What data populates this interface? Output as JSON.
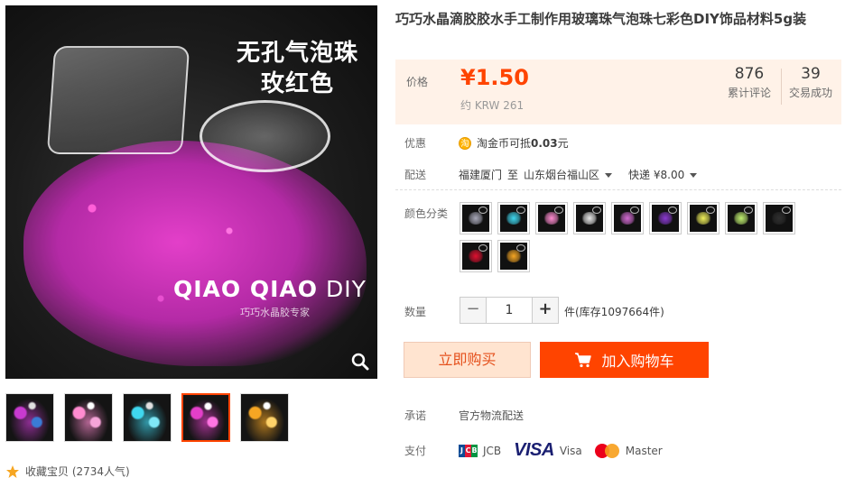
{
  "gallery": {
    "main_overlay_title_line1": "无孔气泡珠",
    "main_overlay_title_line2": "玫红色",
    "brand_bold": "QIAO QIAO",
    "brand_light": " DIY",
    "brand_sub": "巧巧水晶胶专家",
    "zoom_icon": "search-icon",
    "thumbnails": [
      {
        "colors": [
          "#c83ad0",
          "#3a7bd5",
          "#e0e0e0"
        ]
      },
      {
        "colors": [
          "#ff8bd0",
          "#f6a5d9",
          "#ffffff"
        ]
      },
      {
        "colors": [
          "#3fd7ef",
          "#7fe8f7",
          "#e0e0e0"
        ]
      },
      {
        "colors": [
          "#e33fc9",
          "#ff74e2",
          "#ffffff"
        ],
        "active": true
      },
      {
        "colors": [
          "#f6a623",
          "#ffd36a",
          "#ffffff"
        ]
      }
    ],
    "favorite_label": "收藏宝贝 (2734人气)",
    "favorite_icon": "star-icon"
  },
  "product": {
    "title": "巧巧水晶滴胶胶水手工制作用玻璃珠气泡珠七彩色DIY饰品材料5g装"
  },
  "price": {
    "label": "价格",
    "value": "¥1.50",
    "krw": "约 KRW 261",
    "reviews_count": "876",
    "reviews_label": "累计评论",
    "deals_count": "39",
    "deals_label": "交易成功"
  },
  "promo": {
    "label": "优惠",
    "coin_icon": "taojinbi-coin-icon",
    "coin_symbol": "淘",
    "text_prefix": "淘金币可抵",
    "text_amount": "0.03",
    "text_suffix": "元"
  },
  "shipping": {
    "label": "配送",
    "from": "福建厦门",
    "to_word": "至",
    "to": "山东烟台福山区",
    "method": "快递 ¥8.00"
  },
  "colors": {
    "label": "颜色分类",
    "swatches": [
      {
        "fill": "#a8a8b8"
      },
      {
        "fill": "#3fd7ef"
      },
      {
        "fill": "#ff8bd0"
      },
      {
        "fill": "#e8e8e8"
      },
      {
        "fill": "#d06ad0"
      },
      {
        "fill": "#8a3ad0"
      },
      {
        "fill": "#f0f05a"
      },
      {
        "fill": "#c0f070"
      },
      {
        "fill": "#303030"
      },
      {
        "fill": "#e01030"
      },
      {
        "fill": "#f6a623"
      }
    ]
  },
  "quantity": {
    "label": "数量",
    "minus": "−",
    "value": "1",
    "plus": "+",
    "stock": "件(库存1097664件)"
  },
  "actions": {
    "buy_now": "立即购买",
    "add_cart": "加入购物车",
    "cart_icon": "shopping-cart-icon"
  },
  "promise": {
    "label": "承诺",
    "text": "官方物流配送"
  },
  "payment": {
    "label": "支付",
    "methods": [
      "JCB",
      "Visa",
      "Master"
    ],
    "visa_logo_text": "VISA",
    "jcb_logo_letters": [
      "J",
      "C",
      "B"
    ],
    "colors": {
      "jcb": [
        "#0e4c96",
        "#e21836",
        "#009543"
      ],
      "accent": "#ff4400"
    }
  }
}
